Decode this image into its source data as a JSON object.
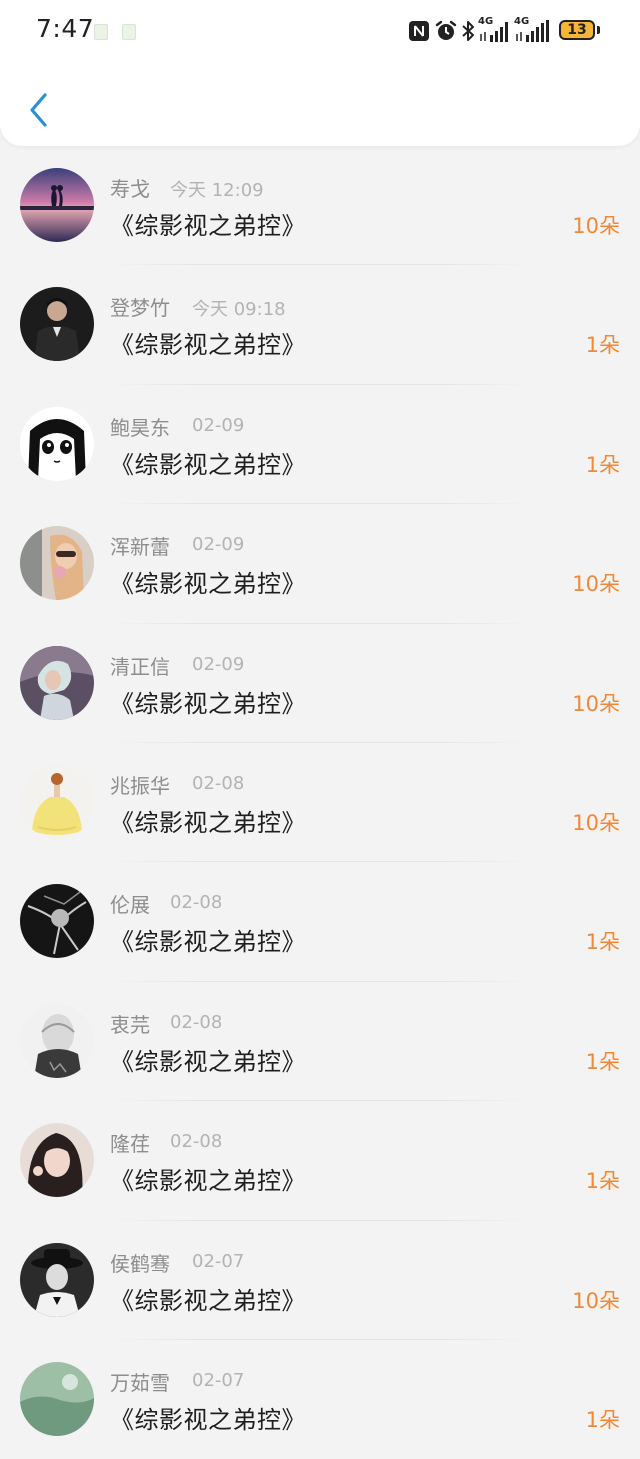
{
  "status_bar": {
    "time": "7:47",
    "network_1": "4G",
    "network_2": "4G",
    "battery": "13",
    "icons": [
      "nfc-icon",
      "alarm-icon",
      "bluetooth-icon",
      "signal-icon",
      "signal-icon",
      "battery-icon"
    ]
  },
  "header": {
    "back_icon": "chevron-left-icon"
  },
  "colors": {
    "accent": "#2b8fd6",
    "amount": "#f0883a",
    "name": "#8d8d8d",
    "date": "#b3b3b3"
  },
  "gifts": [
    {
      "name": "寿戈",
      "date": "今天 12:09",
      "title": "《综影视之弟控》",
      "amount": "10朵"
    },
    {
      "name": "登梦竹",
      "date": "今天 09:18",
      "title": "《综影视之弟控》",
      "amount": "1朵"
    },
    {
      "name": "鲍昊东",
      "date": "02-09",
      "title": "《综影视之弟控》",
      "amount": "1朵"
    },
    {
      "name": "浑新蕾",
      "date": "02-09",
      "title": "《综影视之弟控》",
      "amount": "10朵"
    },
    {
      "name": "清正信",
      "date": "02-09",
      "title": "《综影视之弟控》",
      "amount": "10朵"
    },
    {
      "name": "兆振华",
      "date": "02-08",
      "title": "《综影视之弟控》",
      "amount": "10朵"
    },
    {
      "name": "伦展",
      "date": "02-08",
      "title": "《综影视之弟控》",
      "amount": "1朵"
    },
    {
      "name": "衷芫",
      "date": "02-08",
      "title": "《综影视之弟控》",
      "amount": "1朵"
    },
    {
      "name": "隆荏",
      "date": "02-08",
      "title": "《综影视之弟控》",
      "amount": "1朵"
    },
    {
      "name": "侯鹤骞",
      "date": "02-07",
      "title": "《综影视之弟控》",
      "amount": "10朵"
    },
    {
      "name": "万茹雪",
      "date": "02-07",
      "title": "《综影视之弟控》",
      "amount": "1朵"
    }
  ]
}
